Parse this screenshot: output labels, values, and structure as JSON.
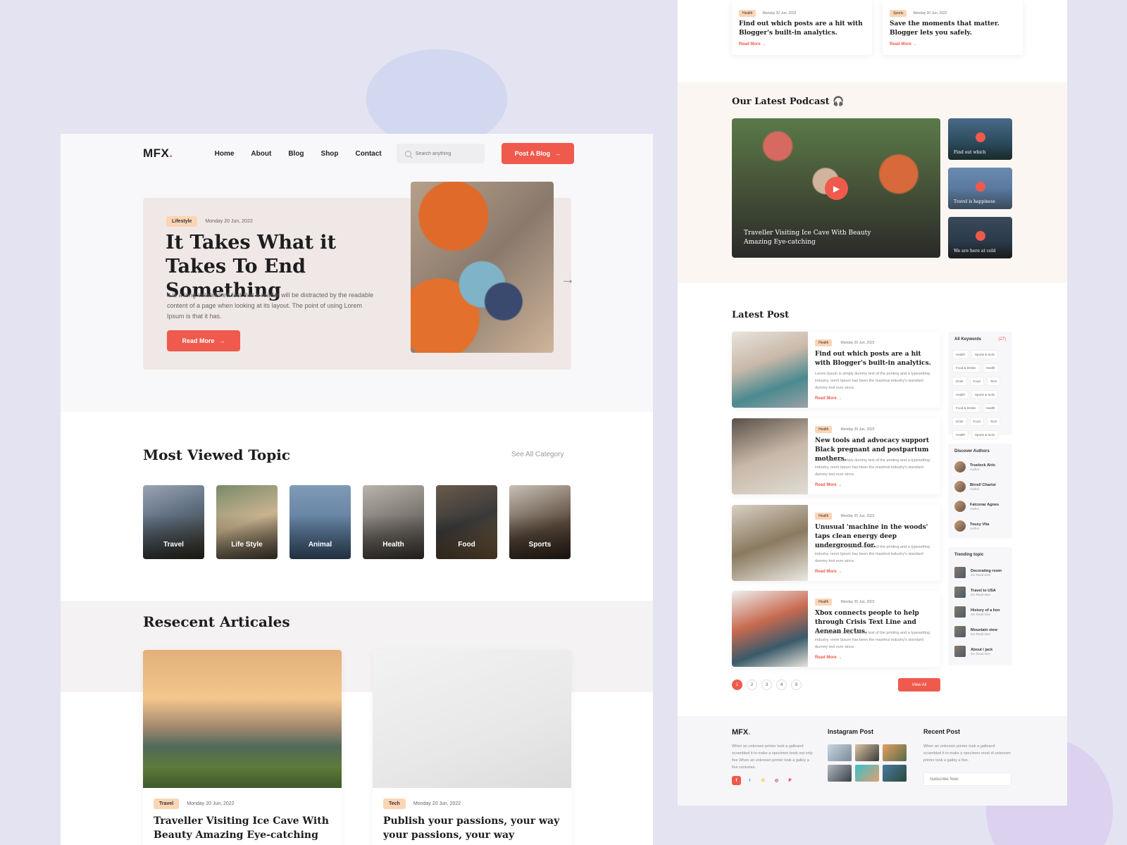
{
  "colors": {
    "accent": "#ef5a4c",
    "badge": "#fcd5b5",
    "background": "#e3e3f1"
  },
  "left": {
    "logo": "MFX",
    "logo_dot": ".",
    "nav": [
      "Home",
      "About",
      "Blog",
      "Shop",
      "Contact"
    ],
    "search_placeholder": "Search anything",
    "post_button": "Post A Blog",
    "hero": {
      "badge": "Lifestyle",
      "date": "Monday 20 Jun, 2022",
      "title": "It Takes What it Takes To End Something",
      "description": "It is a long established fact that a reader will be distracted by the readable content of a page when looking at its layout. The point of using Lorem Ipsum is that it has.",
      "read_more": "Read More"
    },
    "most_viewed": {
      "title": "Most Viewed Topic",
      "see_all": "See All Category",
      "topics": [
        "Travel",
        "Life Style",
        "Animal",
        "Health",
        "Food",
        "Sports"
      ]
    },
    "recent": {
      "title": "Resecent Articales",
      "articles": [
        {
          "badge": "Travel",
          "date": "Monday 20 Jun, 2022",
          "title": "Traveller Visiting Ice Cave With Beauty Amazing Eye-catching"
        },
        {
          "badge": "Tech",
          "date": "Monday 20 Jun, 2022",
          "title": "Publish your passions, your way your passions, your way"
        }
      ]
    }
  },
  "right": {
    "top_cards": [
      {
        "badge": "Health",
        "date": "Monday 20 Jun, 2022",
        "title": "Find out which posts are a hit with Blogger's built-in analytics.",
        "read_more": "Read More →"
      },
      {
        "badge": "Sports",
        "date": "Monday 20 Jun, 2022",
        "title": "Save the moments that matter. Blogger lets you safely.",
        "read_more": "Read More →"
      }
    ],
    "podcast": {
      "title": "Our Latest Podcast",
      "main_caption": "Traveller Visiting Ice Cave With Beauty Amazing Eye-catching",
      "thumbs": [
        "Find out which",
        "Travel is happiness",
        "We are here at cold"
      ]
    },
    "latest": {
      "title": "Latest Post",
      "posts": [
        {
          "badge": "Health",
          "date": "Monday 20 Jun, 2022",
          "title": "Find out which posts are a hit with Blogger's built-in analytics.",
          "desc": "Lorem Ipsum is simply dummy text of the printing and a typesetting industry. orem Ipsum has been the maximul industry's standard dummy text ever since.",
          "read_more": "Read More →"
        },
        {
          "badge": "Health",
          "date": "Monday 20 Jun, 2022",
          "title": "New tools and advocacy support Black pregnant and postpartum mothers.",
          "desc": "Lorem Ipsum is simply dummy text of the printing and a typesetting industry. orem Ipsum has been the maximul industry's standard dummy text ever since.",
          "read_more": "Read More →"
        },
        {
          "badge": "Health",
          "date": "Monday 20 Jun, 2022",
          "title": "Unusual 'machine in the woods' taps clean energy deep underground for.",
          "desc": "Lorem Ipsum is simply dummy text of the printing and a typesetting industry. orem Ipsum has been the maximul industry's standard dummy text ever since.",
          "read_more": "Read More →"
        },
        {
          "badge": "Health",
          "date": "Monday 20 Jun, 2022",
          "title": "Xbox connects people to help through Crisis Text Line and Aenean lectus.",
          "desc": "Lorem Ipsum is simply dummy text of the printing and a typesetting industry. orem Ipsum has been the maximul industry's standard dummy text ever since.",
          "read_more": "Read More →"
        }
      ],
      "pages": [
        "1",
        "2",
        "3",
        "4",
        "9"
      ],
      "view_all": "View All"
    },
    "sidebar": {
      "keywords_title": "All Keywords",
      "keywords_count": "(27)",
      "keywords": [
        "Health",
        "Sports & tools",
        "Food & Drinks",
        "Health",
        "Drink",
        "Food",
        "Tech",
        "Health",
        "Sports & tools",
        "Food & Drinks",
        "Health",
        "Drink",
        "Food",
        "Tech",
        "Health",
        "Sports & tools"
      ],
      "authors_title": "Discover Authors",
      "authors": [
        {
          "name": "Truelock Alric",
          "role": "Author"
        },
        {
          "name": "Birrell Chariot",
          "role": "Author"
        },
        {
          "name": "Falconar Agnes",
          "role": "Author"
        },
        {
          "name": "Tousy Vita",
          "role": "Author"
        }
      ],
      "trending_title": "Trending topic",
      "trending": [
        {
          "name": "Decorating room",
          "meta": "4m Read time"
        },
        {
          "name": "Travel to USA",
          "meta": "5m Read time"
        },
        {
          "name": "History of a lion",
          "meta": "3m Read time"
        },
        {
          "name": "Mountain view",
          "meta": "5m Read time"
        },
        {
          "name": "About i jack",
          "meta": "5m Read time"
        }
      ]
    },
    "footer": {
      "logo": "MFX",
      "logo_dot": ".",
      "about": "When an unknown printer took a galleand scrambled it to make a specimen book not only five When an unknown printer took a galley a five centuries.",
      "insta_title": "Instagram Post",
      "recent_title": "Recent Post",
      "recent_text": "When an unknown printer took a galleand scrambled it to make a specimen most of unknown printer took a galley a five.",
      "subscribe_placeholder": "Subscribe Now",
      "socials": [
        "f",
        "t",
        "G",
        "◎",
        "P"
      ]
    }
  }
}
